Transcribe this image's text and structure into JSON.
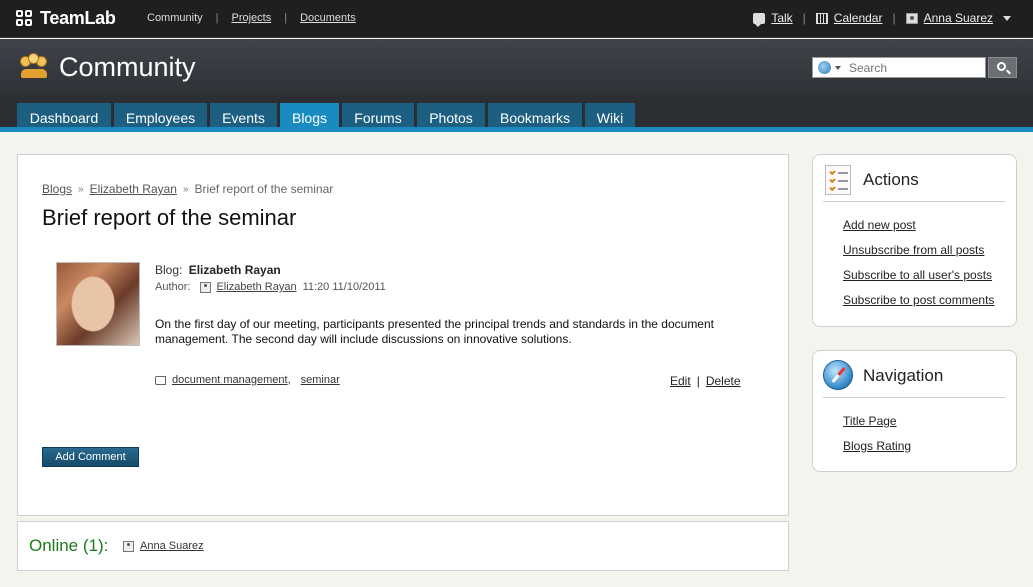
{
  "topbar": {
    "brand": "TeamLab",
    "links": [
      "Community",
      "Projects",
      "Documents"
    ],
    "talk": "Talk",
    "calendar": "Calendar",
    "user": "Anna Suarez",
    "separator": "|"
  },
  "header": {
    "title": "Community",
    "search_placeholder": "Search"
  },
  "tabs": [
    {
      "label": "Dashboard"
    },
    {
      "label": "Employees"
    },
    {
      "label": "Events"
    },
    {
      "label": "Blogs",
      "active": true
    },
    {
      "label": "Forums"
    },
    {
      "label": "Photos"
    },
    {
      "label": "Bookmarks"
    },
    {
      "label": "Wiki"
    }
  ],
  "post": {
    "breadcrumb": [
      "Blogs",
      "Elizabeth Rayan",
      "Brief report of the seminar"
    ],
    "breadcrumb_sep": "»",
    "title": "Brief report of the seminar",
    "blog_label": "Blog:",
    "blog_name": "Elizabeth Rayan",
    "author_label": "Author:",
    "author_name": "Elizabeth Rayan",
    "timestamp": "11:20 11/10/2011",
    "body": "On the first day of our meeting, participants presented the principal trends and standards in the document management. The second day will include discussions on innovative solutions.",
    "tags": [
      "document management",
      "seminar"
    ],
    "tag_sep": ",",
    "edit_label": "Edit",
    "delete_label": "Delete",
    "actions_sep": "|",
    "add_comment_label": "Add Comment"
  },
  "online": {
    "label": "Online (1):",
    "users": [
      "Anna Suarez"
    ]
  },
  "sidebar": {
    "actions": {
      "title": "Actions",
      "links": [
        "Add new post",
        "Unsubscribe from all posts",
        "Subscribe to all user's posts",
        "Subscribe to post comments"
      ]
    },
    "navigation": {
      "title": "Navigation",
      "links": [
        "Title Page",
        "Blogs Rating"
      ]
    }
  },
  "colors": {
    "tab_active": "#1a8bc1",
    "tab_inactive": "#1c5f80",
    "online_green": "#1a7a1a",
    "accent_blue": "#1a8bc1"
  }
}
